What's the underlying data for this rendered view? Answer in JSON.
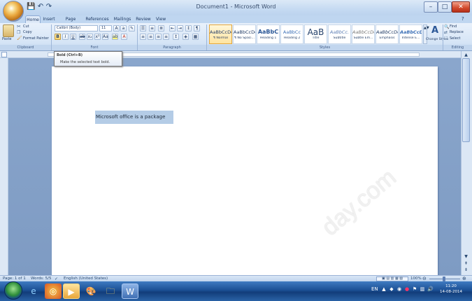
{
  "window": {
    "title": "Document1 - Microsoft Word",
    "controls": {
      "minimize": "–",
      "maximize": "□",
      "close": "✕"
    }
  },
  "quick_access": {
    "save": "💾",
    "undo": "↶",
    "redo": "↷"
  },
  "tabs": [
    "Home",
    "Insert",
    "Page Layout",
    "References",
    "Mailings",
    "Review",
    "View"
  ],
  "active_tab": "Home",
  "ribbon": {
    "clipboard": {
      "paste": "Paste",
      "cut": "Cut",
      "copy": "Copy",
      "format_painter": "Format Painter",
      "label": "Clipboard"
    },
    "font": {
      "font_name": "Calibri (Body)",
      "font_size": "11",
      "label": "Font"
    },
    "paragraph": {
      "label": "Paragraph"
    },
    "styles": {
      "items": [
        {
          "preview": "AaBbCcDc",
          "name": "¶ Normal"
        },
        {
          "preview": "AaBbCcDc",
          "name": "¶ No Spaci..."
        },
        {
          "preview": "AaBbC",
          "name": "Heading 1"
        },
        {
          "preview": "AaBbCc",
          "name": "Heading 2"
        },
        {
          "preview": "AaB",
          "name": "Title"
        },
        {
          "preview": "AaBbCc.",
          "name": "Subtitle"
        },
        {
          "preview": "AaBbCcDc",
          "name": "Subtle Em..."
        },
        {
          "preview": "AaBbCcDc",
          "name": "Emphasis"
        },
        {
          "preview": "AaBbCcDc",
          "name": "Intense E..."
        }
      ],
      "change_styles": "Change Styles",
      "label": "Styles"
    },
    "editing": {
      "find": "Find",
      "replace": "Replace",
      "select": "Select",
      "label": "Editing"
    }
  },
  "tooltip": {
    "title": "Bold (Ctrl+B)",
    "description": "Make the selected text bold."
  },
  "document": {
    "text": "Microsoft office is a package"
  },
  "statusbar": {
    "page": "Page: 1 of 1",
    "words": "Words: 5/5",
    "language": "English (United States)",
    "zoom": "100%"
  },
  "taskbar": {
    "time": "11:20",
    "date": "14-08-2014"
  },
  "watermark": "day.com",
  "colors": {
    "ribbon": "#d6e5f6",
    "selection": "#b4cce6",
    "canvas": "#8aa6cc",
    "taskbar": "#1b4f94"
  }
}
